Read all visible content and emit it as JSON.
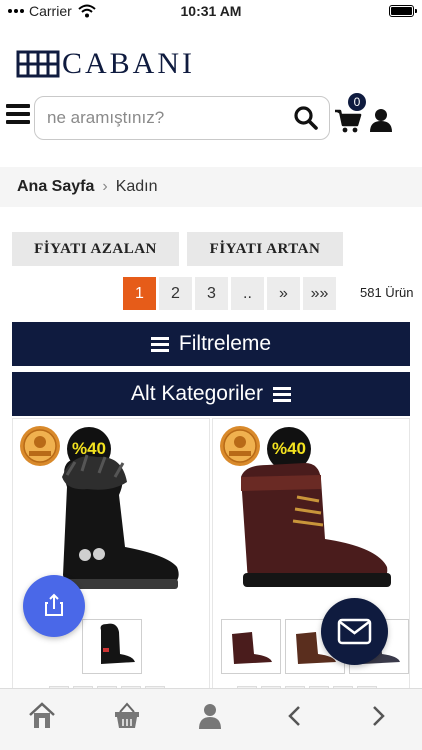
{
  "status_bar": {
    "carrier": "Carrier",
    "time": "10:31 AM"
  },
  "header": {
    "logo_text": "CABANI"
  },
  "search": {
    "placeholder": "ne aramıştınız?"
  },
  "cart": {
    "count": "0"
  },
  "breadcrumb": {
    "home": "Ana Sayfa",
    "separator": "›",
    "current": "Kadın"
  },
  "sort": {
    "desc_label": "FİYATI AZALAN",
    "asc_label": "FİYATI ARTAN"
  },
  "pagination": {
    "pages": [
      "1",
      "2",
      "3",
      "..",
      "»",
      "»»"
    ],
    "active_page": "1",
    "product_count": "581 Ürün"
  },
  "filter_bar": {
    "label": "Filtreleme"
  },
  "category_bar": {
    "label": "Alt Kategoriler"
  },
  "products": [
    {
      "discount": "%40",
      "color": "black"
    },
    {
      "discount": "%40",
      "color": "brown"
    }
  ],
  "icons": {
    "menu": "hamburger-icon",
    "search": "search-icon",
    "cart": "cart-icon",
    "user": "user-icon",
    "share": "share-icon",
    "message": "envelope-icon",
    "nav": [
      "home-icon",
      "basket-icon",
      "profile-icon",
      "back-icon",
      "forward-icon"
    ]
  },
  "colors": {
    "brand_navy": "#0f1b3f",
    "active_page": "#e65c19",
    "share_fab": "#4a68e8",
    "discount_text": "#f3e21f"
  }
}
